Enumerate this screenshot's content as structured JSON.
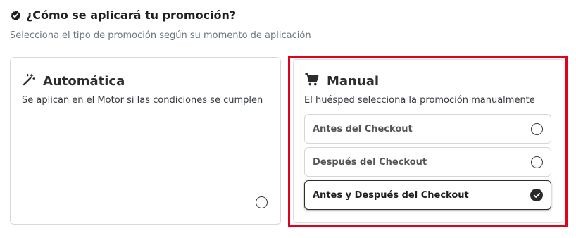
{
  "header": {
    "title": "¿Cómo se aplicará tu promoción?",
    "subtitle": "Selecciona el tipo de promoción según su momento de aplicación"
  },
  "cards": {
    "automatic": {
      "name": "Automática",
      "description": "Se aplican en el Motor si las condiciones se cumplen",
      "icon": "magic-wand-icon",
      "selected": false
    },
    "manual": {
      "name": "Manual",
      "description": "El huésped selecciona la promoción manualmente",
      "icon": "shopping-cart-icon",
      "selected": true,
      "highlight_color": "#e4001b",
      "options": [
        {
          "label": "Antes del Checkout",
          "selected": false
        },
        {
          "label": "Después del Checkout",
          "selected": false
        },
        {
          "label": "Antes y Después del Checkout",
          "selected": true
        }
      ]
    }
  }
}
